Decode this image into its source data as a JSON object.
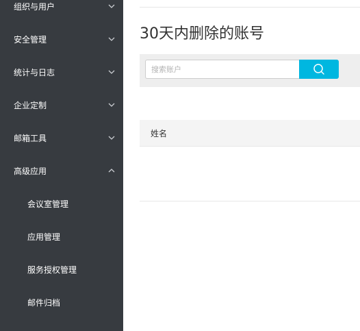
{
  "sidebar": {
    "items": [
      {
        "label": "组织与用户",
        "icon": "chevron-down-icon",
        "expanded": false
      },
      {
        "label": "安全管理",
        "icon": "chevron-down-icon",
        "expanded": false
      },
      {
        "label": "统计与日志",
        "icon": "chevron-down-icon",
        "expanded": false
      },
      {
        "label": "企业定制",
        "icon": "chevron-down-icon",
        "expanded": false
      },
      {
        "label": "邮箱工具",
        "icon": "chevron-down-icon",
        "expanded": false
      },
      {
        "label": "高级应用",
        "icon": "chevron-up-icon",
        "expanded": true
      }
    ],
    "subitems": [
      {
        "label": "会议室管理"
      },
      {
        "label": "应用管理"
      },
      {
        "label": "服务授权管理"
      },
      {
        "label": "邮件归档"
      }
    ]
  },
  "main": {
    "title": "30天内删除的账号",
    "search": {
      "placeholder": "搜索账户",
      "value": "",
      "button_icon": "search-icon"
    },
    "table": {
      "headers": [
        "姓名"
      ],
      "rows": []
    }
  },
  "colors": {
    "sidebar_bg": "#373b40",
    "accent": "#00b7e0",
    "search_bar_bg": "#eeeeee",
    "table_header_bg": "#f4f4f4"
  }
}
